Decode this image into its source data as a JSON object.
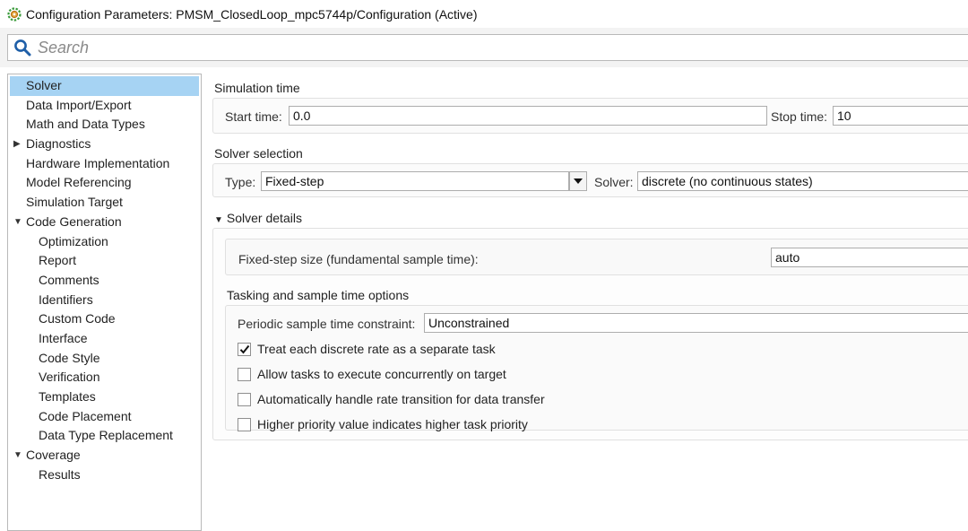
{
  "window": {
    "title": "Configuration Parameters: PMSM_ClosedLoop_mpc5744p/Configuration (Active)"
  },
  "search": {
    "placeholder": "Search"
  },
  "sidebar": {
    "items": [
      {
        "label": "Solver",
        "level": 0,
        "selected": true
      },
      {
        "label": "Data Import/Export",
        "level": 0
      },
      {
        "label": "Math and Data Types",
        "level": 0
      },
      {
        "label": "Diagnostics",
        "level": 0,
        "arrow": "collapsed"
      },
      {
        "label": "Hardware Implementation",
        "level": 0
      },
      {
        "label": "Model Referencing",
        "level": 0
      },
      {
        "label": "Simulation Target",
        "level": 0
      },
      {
        "label": "Code Generation",
        "level": 0,
        "arrow": "expanded"
      },
      {
        "label": "Optimization",
        "level": 1
      },
      {
        "label": "Report",
        "level": 1
      },
      {
        "label": "Comments",
        "level": 1
      },
      {
        "label": "Identifiers",
        "level": 1
      },
      {
        "label": "Custom Code",
        "level": 1
      },
      {
        "label": "Interface",
        "level": 1
      },
      {
        "label": "Code Style",
        "level": 1
      },
      {
        "label": "Verification",
        "level": 1
      },
      {
        "label": "Templates",
        "level": 1
      },
      {
        "label": "Code Placement",
        "level": 1
      },
      {
        "label": "Data Type Replacement",
        "level": 1
      },
      {
        "label": "Coverage",
        "level": 0,
        "arrow": "expanded"
      },
      {
        "label": "Results",
        "level": 1
      }
    ]
  },
  "simulation_time": {
    "heading": "Simulation time",
    "start_label": "Start time:",
    "start_value": "0.0",
    "stop_label": "Stop time:",
    "stop_value": "10"
  },
  "solver_selection": {
    "heading": "Solver selection",
    "type_label": "Type:",
    "type_value": "Fixed-step",
    "solver_label": "Solver:",
    "solver_value": "discrete (no continuous states)"
  },
  "solver_details": {
    "heading": "Solver details",
    "step_size_label": "Fixed-step size (fundamental sample time):",
    "step_size_value": "auto",
    "tasking_heading": "Tasking and sample time options",
    "periodic_label": "Periodic sample time constraint:",
    "periodic_value": "Unconstrained",
    "checkboxes": [
      {
        "label": "Treat each discrete rate as a separate task",
        "checked": true
      },
      {
        "label": "Allow tasks to execute concurrently on target",
        "checked": false
      },
      {
        "label": "Automatically handle rate transition for data transfer",
        "checked": false
      },
      {
        "label": "Higher priority value indicates higher task priority",
        "checked": false
      }
    ]
  },
  "icons": {
    "app": "simulink-gear-icon",
    "search": "search-icon",
    "expand": "triangle-down-icon",
    "collapse": "triangle-right-icon",
    "dropdown": "chevron-down-icon",
    "check": "checkmark-icon"
  },
  "colors": {
    "selection": "#a6d3f3",
    "search_bar": "#f3f3f3",
    "icon_blue": "#1f5fa8",
    "icon_green": "#3a9a3a"
  }
}
